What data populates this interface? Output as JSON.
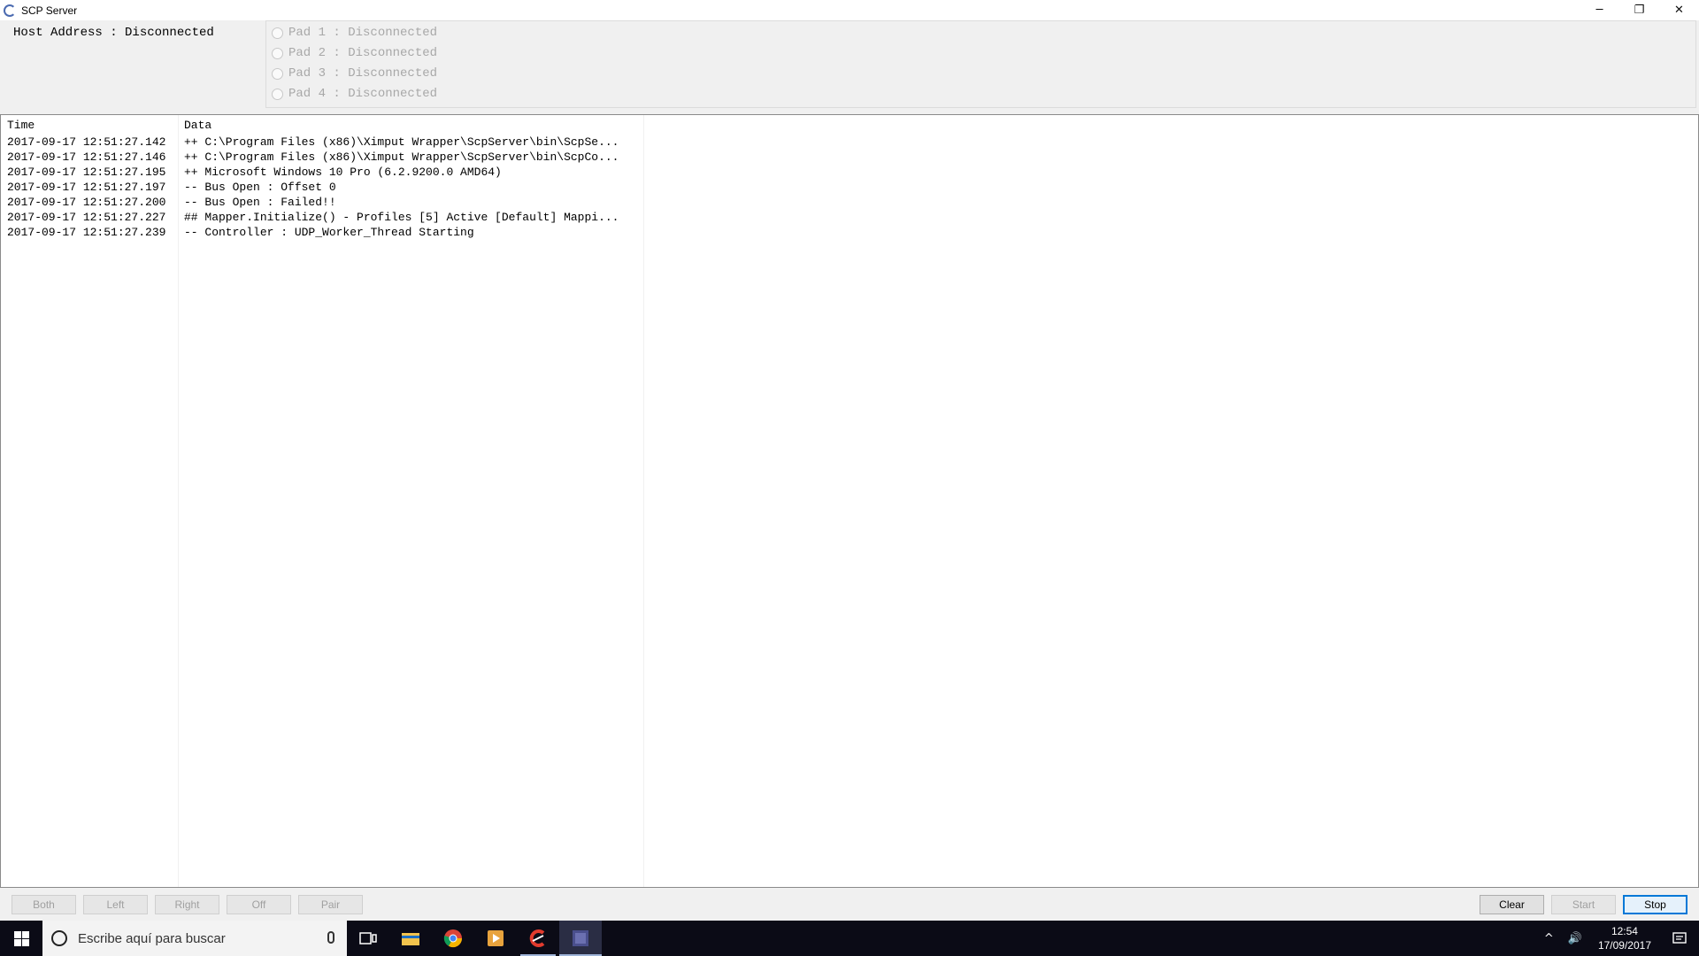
{
  "window": {
    "title": "SCP Server",
    "controls": {
      "minimize": "─",
      "restore": "❐",
      "close": "✕"
    }
  },
  "top": {
    "host_address": "Host Address : Disconnected",
    "pads": [
      {
        "label": "Pad 1 : Disconnected"
      },
      {
        "label": "Pad 2 : Disconnected"
      },
      {
        "label": "Pad 3 : Disconnected"
      },
      {
        "label": "Pad 4 : Disconnected"
      }
    ]
  },
  "log": {
    "columns": [
      "Time",
      "Data"
    ],
    "rows": [
      {
        "time": "2017-09-17 12:51:27.142",
        "data": "++ C:\\Program Files (x86)\\Ximput Wrapper\\ScpServer\\bin\\ScpSe..."
      },
      {
        "time": "2017-09-17 12:51:27.146",
        "data": "++ C:\\Program Files (x86)\\Ximput Wrapper\\ScpServer\\bin\\ScpCo..."
      },
      {
        "time": "2017-09-17 12:51:27.195",
        "data": "++ Microsoft Windows 10 Pro (6.2.9200.0 AMD64)"
      },
      {
        "time": "2017-09-17 12:51:27.197",
        "data": "-- Bus Open   : Offset 0"
      },
      {
        "time": "2017-09-17 12:51:27.200",
        "data": "-- Bus Open   : Failed!!"
      },
      {
        "time": "2017-09-17 12:51:27.227",
        "data": "## Mapper.Initialize() - Profiles [5] Active [Default] Mappi..."
      },
      {
        "time": "2017-09-17 12:51:27.239",
        "data": "-- Controller : UDP_Worker_Thread Starting"
      }
    ]
  },
  "buttons": {
    "both": "Both",
    "left": "Left",
    "right": "Right",
    "off": "Off",
    "pair": "Pair",
    "clear": "Clear",
    "start": "Start",
    "stop": "Stop"
  },
  "taskbar": {
    "search_placeholder": "Escribe aquí para buscar",
    "time": "12:54",
    "date": "17/09/2017",
    "apps": [
      "task-view",
      "file-explorer",
      "chrome",
      "media-player",
      "ccleaner",
      "scp-server"
    ]
  },
  "colors": {
    "accent": "#0078d7",
    "taskbar_bg": "#0b0b16",
    "disabled_text": "#a8a8a8"
  }
}
